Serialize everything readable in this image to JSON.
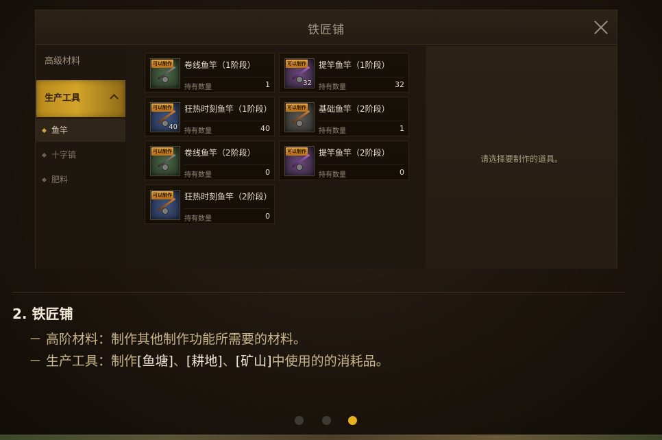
{
  "modal": {
    "title": "铁匠铺",
    "close_label": "×"
  },
  "sidebar": {
    "categories": [
      {
        "label": "高级材料",
        "active": false
      },
      {
        "label": "生产工具",
        "active": true,
        "expanded": true
      }
    ],
    "subitems": [
      {
        "label": "鱼竿",
        "selected": true
      },
      {
        "label": "十字镐",
        "selected": false
      },
      {
        "label": "肥料",
        "selected": false
      }
    ]
  },
  "items": [
    {
      "badge": "可以制作",
      "name": "卷线鱼竿（1阶段）",
      "hold_label": "持有数量",
      "qty": "1",
      "icon_count": "",
      "icon_color": "green",
      "icon": "fishing-rod-icon"
    },
    {
      "badge": "可以制作",
      "name": "提竿鱼竿（1阶段）",
      "hold_label": "持有数量",
      "qty": "32",
      "icon_count": "32",
      "icon_color": "purple",
      "icon": "fishing-rod-icon"
    },
    {
      "badge": "可以制作",
      "name": "狂热时刻鱼竿（1阶段）",
      "hold_label": "持有数量",
      "qty": "40",
      "icon_count": "40",
      "icon_color": "blue",
      "icon": "fishing-rod-icon"
    },
    {
      "badge": "可以制作",
      "name": "基础鱼竿（2阶段）",
      "hold_label": "持有数量",
      "qty": "1",
      "icon_count": "",
      "icon_color": "gray",
      "icon": "fishing-rod-icon"
    },
    {
      "badge": "可以制作",
      "name": "卷线鱼竿（2阶段）",
      "hold_label": "持有数量",
      "qty": "0",
      "icon_count": "",
      "icon_color": "green",
      "icon": "fishing-rod-icon"
    },
    {
      "badge": "可以制作",
      "name": "提竿鱼竿（2阶段）",
      "hold_label": "持有数量",
      "qty": "0",
      "icon_count": "",
      "icon_color": "purple",
      "icon": "fishing-rod-icon"
    },
    {
      "badge": "可以制作",
      "name": "狂热时刻鱼竿（2阶段）",
      "hold_label": "持有数量",
      "qty": "0",
      "icon_count": "",
      "icon_color": "blue",
      "icon": "fishing-rod-icon"
    }
  ],
  "detail": {
    "hint": "请选择要制作的道具。"
  },
  "explanation": {
    "title": "2. 铁匠铺",
    "line1": "－ 高阶材料：制作其他制作功能所需要的材料。",
    "line2_prefix": "－ 生产工具：制作",
    "line2_hl1": "[鱼塘]",
    "line2_sep1": "、",
    "line2_hl2": "[耕地]",
    "line2_sep2": "、",
    "line2_hl3": "[矿山]",
    "line2_suffix": "中使用的的消耗品。"
  },
  "pager": {
    "count": 3,
    "active_index": 2
  },
  "colors": {
    "accent_gold": "#d4a52a",
    "badge_orange": "#e9a53a",
    "pager_active": "#e6b020"
  }
}
